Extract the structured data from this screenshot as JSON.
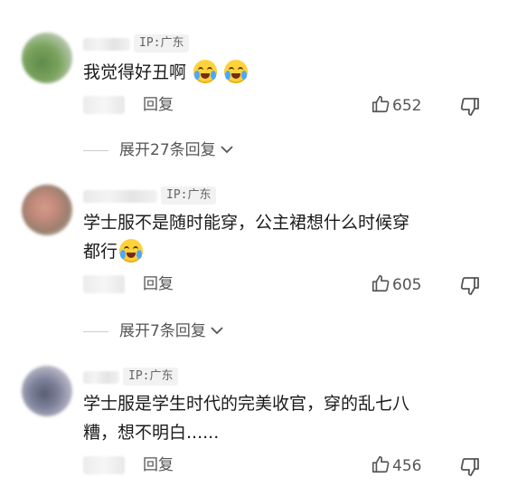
{
  "comments": [
    {
      "ip": "IP:广东",
      "text": "我觉得好丑啊",
      "emoji_count": 2,
      "reply_label": "回复",
      "likes": "652",
      "expand": {
        "label": "展开27条回复"
      }
    },
    {
      "ip": "IP:广东",
      "text_line1": "学士服不是随时能穿，公主裙想什么时候穿",
      "text_line2": "都行",
      "emoji_count": 1,
      "reply_label": "回复",
      "likes": "605",
      "expand": {
        "label": "展开7条回复"
      }
    },
    {
      "ip": "IP:广东",
      "text_line1": "学士服是学生时代的完美收官，穿的乱七八",
      "text_line2": "糟，想不明白......",
      "reply_label": "回复",
      "likes": "456"
    }
  ],
  "icons": {
    "like": "thumbs-up-icon",
    "dislike": "thumbs-down-icon",
    "expand": "chevron-down-icon",
    "emoji": "laugh-cry-emoji"
  }
}
